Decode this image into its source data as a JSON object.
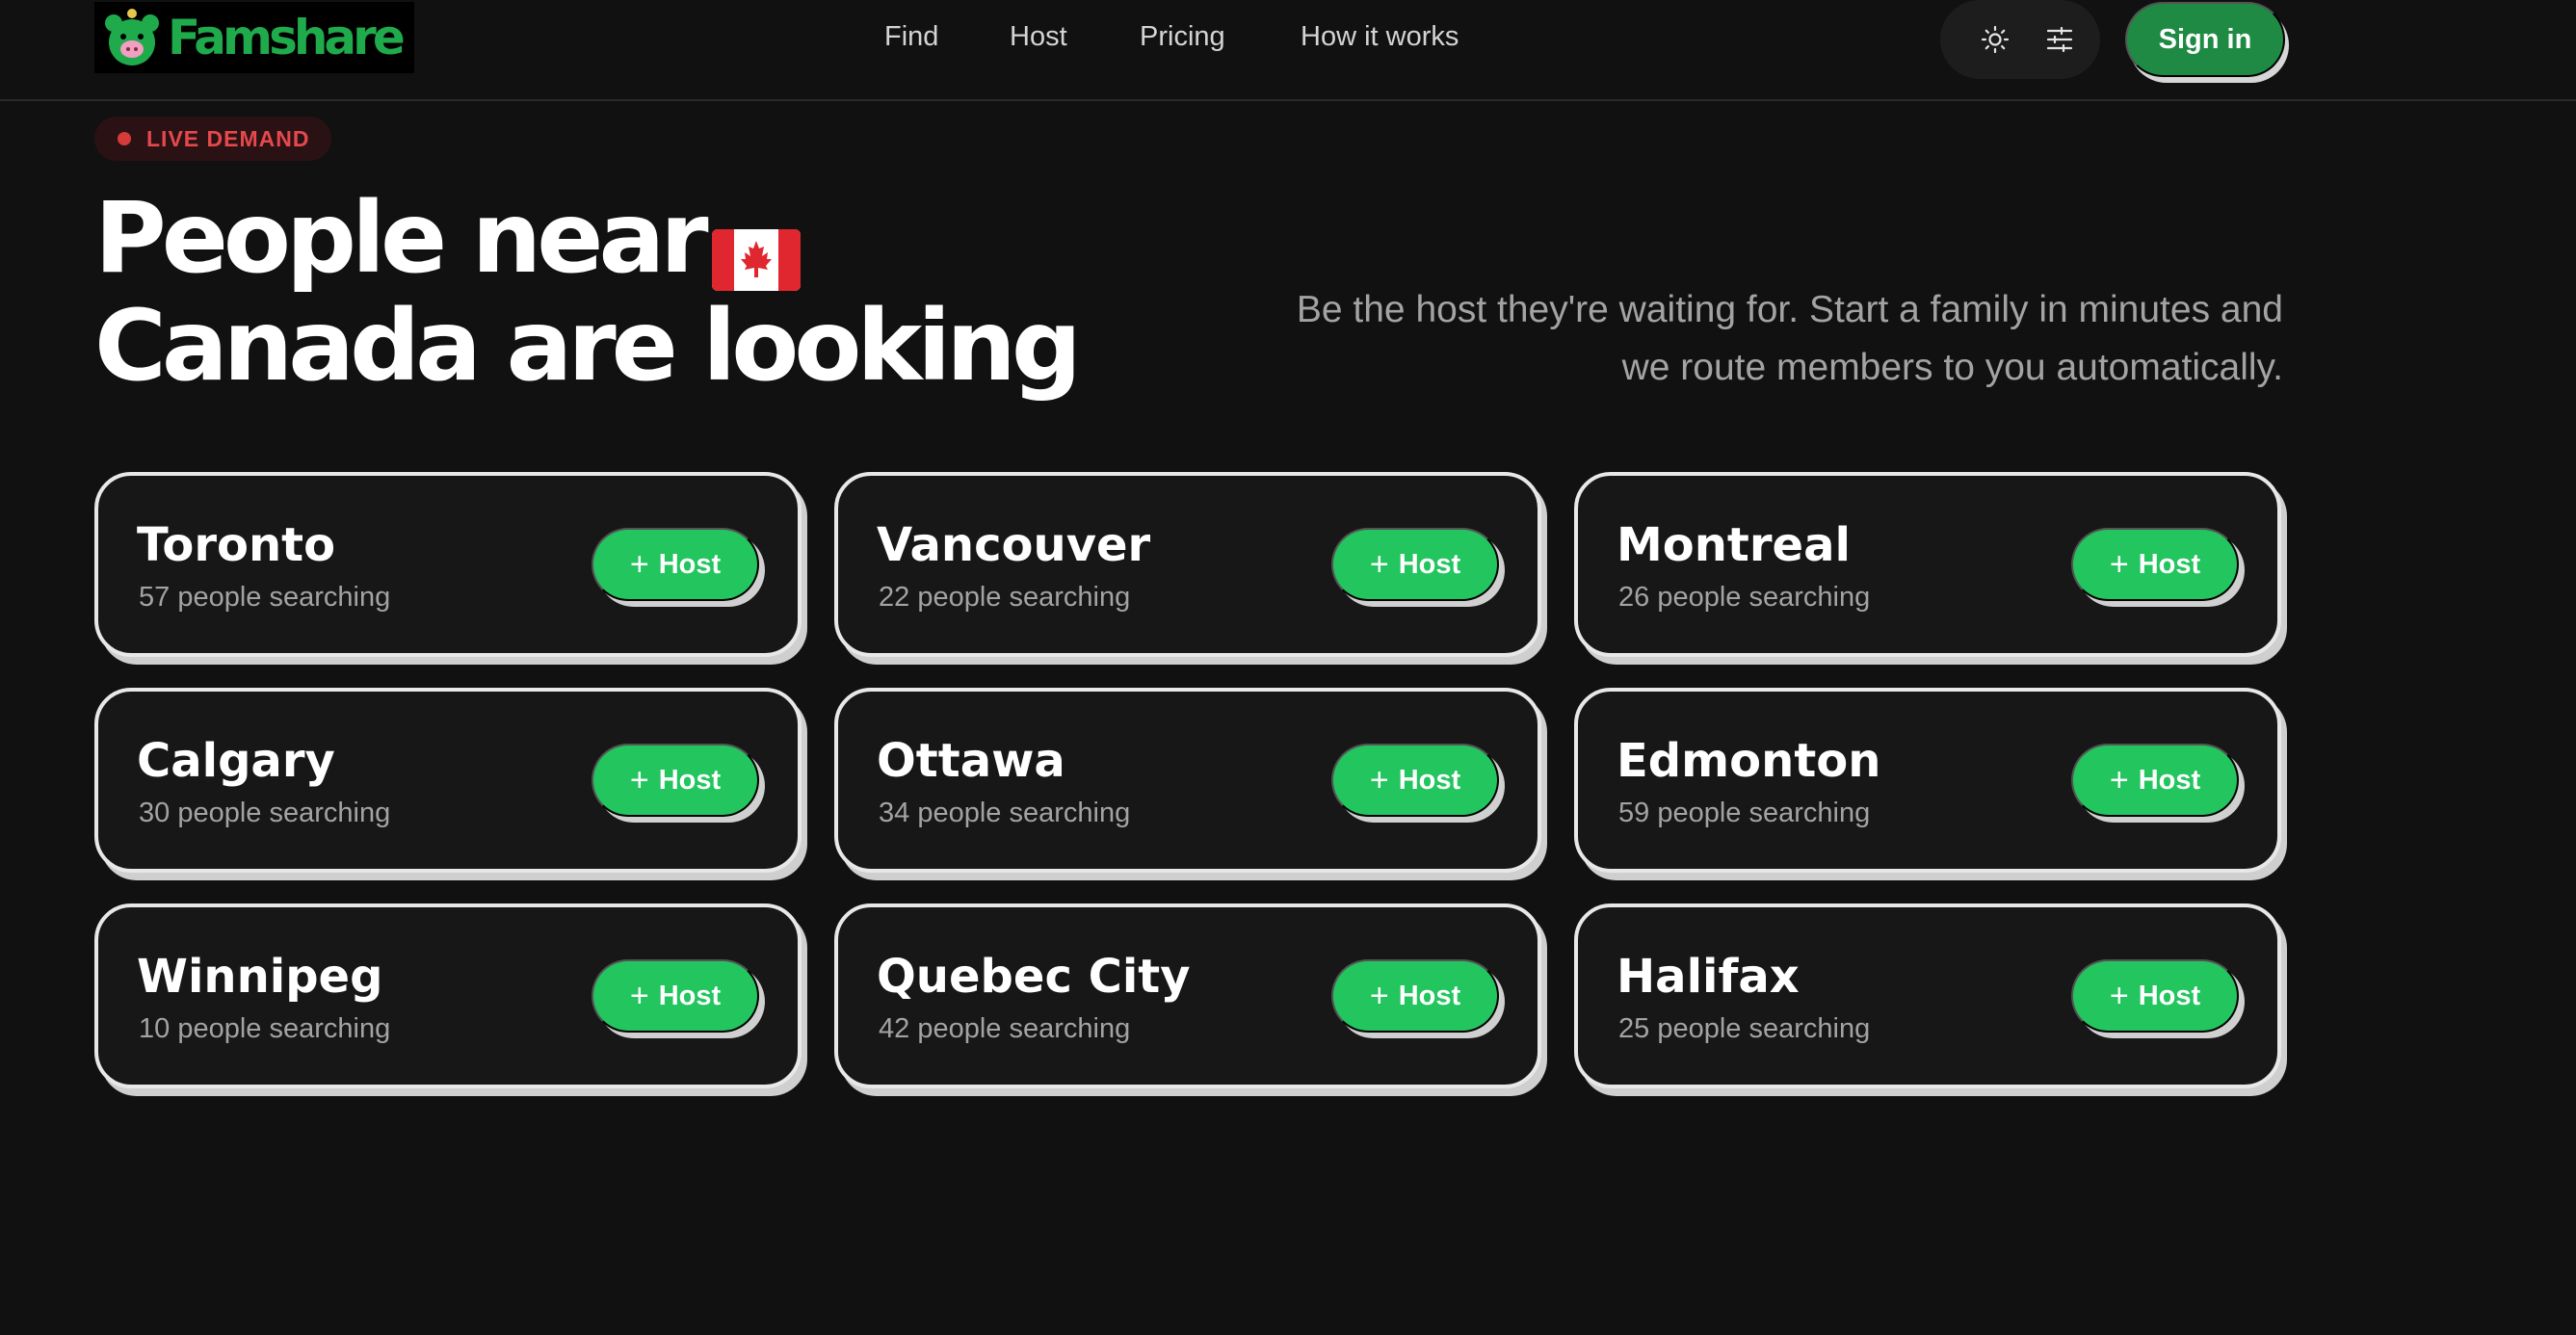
{
  "brand": {
    "name": "Famshare"
  },
  "nav": {
    "links": [
      "Find",
      "Host",
      "Pricing",
      "How it works"
    ],
    "signin_label": "Sign in",
    "icons": [
      "sun-icon",
      "sliders-icon"
    ]
  },
  "hero": {
    "badge": "LIVE DEMAND",
    "headline_line1": "People near",
    "headline_line2": "Canada are looking",
    "flag": "canada-flag",
    "subtext_line1": "Be the host they're waiting for. Start a family in minutes and",
    "subtext_line2": "we route members to you automatically."
  },
  "host_label": "Host",
  "cities": [
    {
      "name": "Toronto",
      "searching": "57 people searching"
    },
    {
      "name": "Vancouver",
      "searching": "22 people searching"
    },
    {
      "name": "Montreal",
      "searching": "26 people searching"
    },
    {
      "name": "Calgary",
      "searching": "30 people searching"
    },
    {
      "name": "Ottawa",
      "searching": "34 people searching"
    },
    {
      "name": "Edmonton",
      "searching": "59 people searching"
    },
    {
      "name": "Winnipeg",
      "searching": "10 people searching"
    },
    {
      "name": "Quebec City",
      "searching": "42 people searching"
    },
    {
      "name": "Halifax",
      "searching": "25 people searching"
    }
  ],
  "colors": {
    "background": "#111111",
    "accent": "#22c55e",
    "signin": "#1e8a44",
    "live": "#e5484d"
  }
}
